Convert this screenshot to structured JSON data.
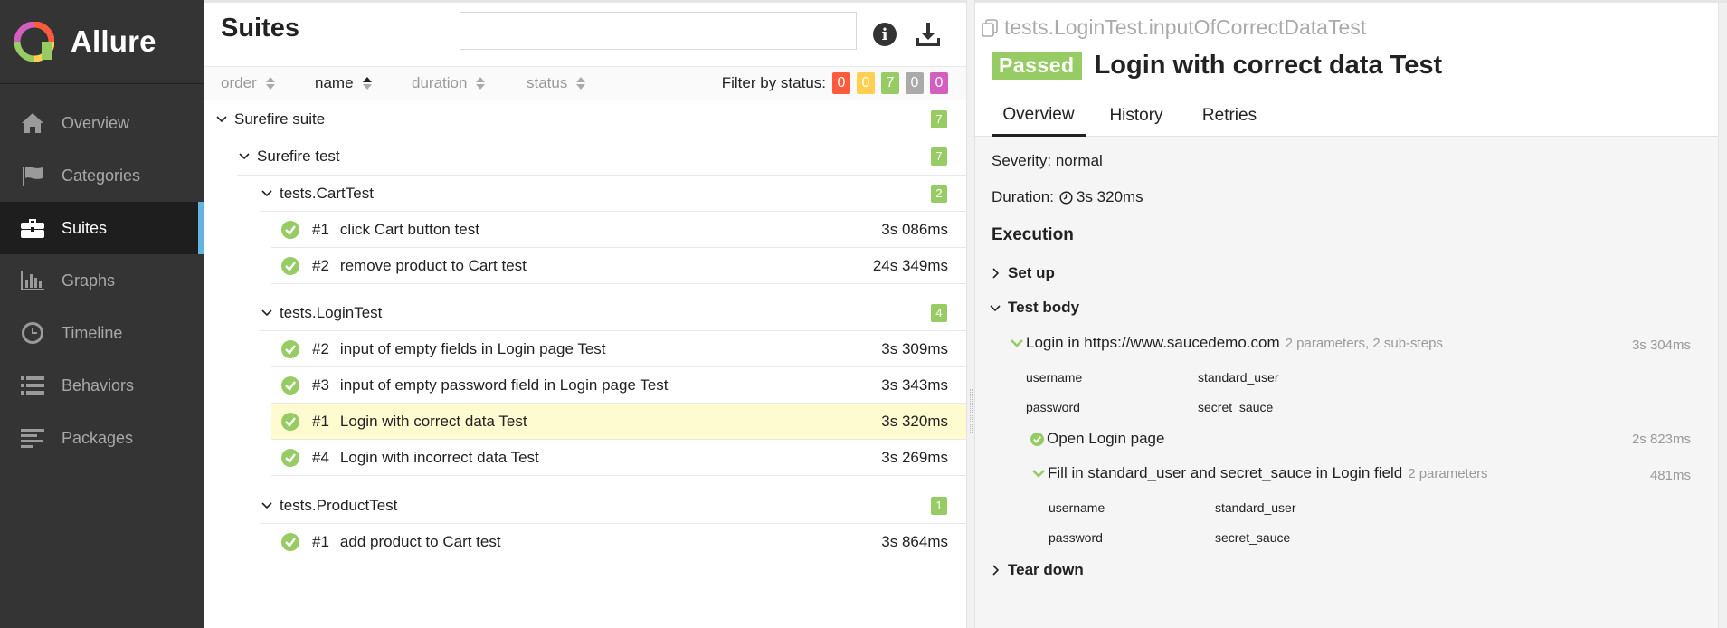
{
  "brand": {
    "name": "Allure"
  },
  "nav": [
    {
      "label": "Overview",
      "icon": "home-icon"
    },
    {
      "label": "Categories",
      "icon": "flag-icon"
    },
    {
      "label": "Suites",
      "icon": "briefcase-icon",
      "active": true
    },
    {
      "label": "Graphs",
      "icon": "bar-chart-icon"
    },
    {
      "label": "Timeline",
      "icon": "clock-icon"
    },
    {
      "label": "Behaviors",
      "icon": "list-icon"
    },
    {
      "label": "Packages",
      "icon": "align-left-icon"
    }
  ],
  "suites": {
    "title": "Suites",
    "search_value": "",
    "sort": {
      "order": "order",
      "name": "name",
      "duration": "duration",
      "status": "status",
      "active": "name"
    },
    "filter": {
      "label": "Filter by status:",
      "counts": [
        {
          "value": "0",
          "color": "#fd5a3e"
        },
        {
          "value": "0",
          "color": "#ffd050"
        },
        {
          "value": "7",
          "color": "#97cc64"
        },
        {
          "value": "0",
          "color": "#aaaaaa"
        },
        {
          "value": "0",
          "color": "#d35ebe"
        }
      ]
    },
    "tree": {
      "suite": {
        "name": "Surefire suite",
        "count": "7"
      },
      "test": {
        "name": "Surefire test",
        "count": "7"
      },
      "groups": [
        {
          "name": "tests.CartTest",
          "count": "2",
          "items": [
            {
              "num": "#1",
              "name": "click Cart button test",
              "duration": "3s 086ms"
            },
            {
              "num": "#2",
              "name": "remove product to Cart test",
              "duration": "24s 349ms"
            }
          ]
        },
        {
          "name": "tests.LoginTest",
          "count": "4",
          "items": [
            {
              "num": "#2",
              "name": "input of empty fields in Login page Test",
              "duration": "3s 309ms"
            },
            {
              "num": "#3",
              "name": "input of empty password field in Login page Test",
              "duration": "3s 343ms"
            },
            {
              "num": "#1",
              "name": "Login with correct data Test",
              "duration": "3s 320ms"
            },
            {
              "num": "#4",
              "name": "Login with incorrect data Test",
              "duration": "3s 269ms"
            }
          ]
        },
        {
          "name": "tests.ProductTest",
          "count": "1",
          "items": [
            {
              "num": "#1",
              "name": "add product to Cart test",
              "duration": "3s 864ms"
            }
          ]
        }
      ]
    }
  },
  "detail": {
    "path": "tests.LoginTest.inputOfCorrectDataTest",
    "status": "Passed",
    "title": "Login with correct data Test",
    "tabs": [
      "Overview",
      "History",
      "Retries"
    ],
    "severity": "Severity: normal",
    "duration_label": "Duration:",
    "duration_value": "3s 320ms",
    "execution_title": "Execution",
    "setup": "Set up",
    "test_body": "Test body",
    "teardown": "Tear down",
    "steps": {
      "login": {
        "name": "Login in https://www.saucedemo.com",
        "meta": "2 parameters, 2 sub-steps",
        "duration": "3s 304ms"
      },
      "login_params": [
        {
          "key": "username",
          "value": "standard_user"
        },
        {
          "key": "password",
          "value": "secret_sauce"
        }
      ],
      "open": {
        "name": "Open Login page",
        "duration": "2s 823ms"
      },
      "fill": {
        "name": "Fill in standard_user and secret_sauce in Login field",
        "meta": "2 parameters",
        "duration": "481ms"
      },
      "fill_params": [
        {
          "key": "username",
          "value": "standard_user"
        },
        {
          "key": "password",
          "value": "secret_sauce"
        }
      ]
    }
  }
}
